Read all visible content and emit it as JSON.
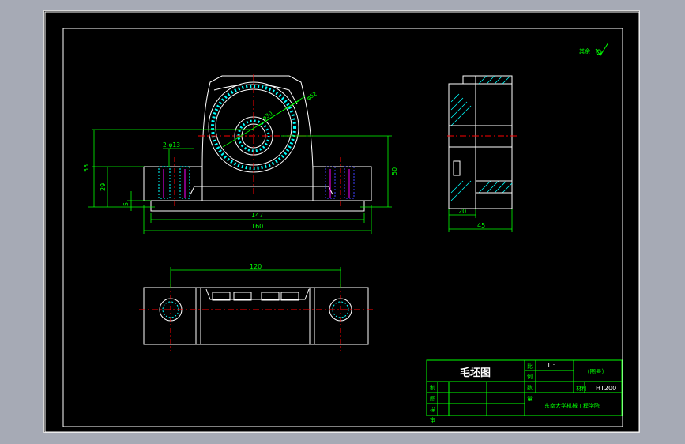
{
  "colors": {
    "background": "#000000",
    "frame": "#ffffff",
    "outline": "#ffffff",
    "dimension": "#00ff00",
    "centerline": "#ff0000",
    "hatch": "#00ffff",
    "hatch_alt": "#4040ff",
    "title_block": "#00ff00"
  },
  "front_view": {
    "labels": {
      "holes": "2-φ13",
      "bore_inner": "φ30",
      "bore_outer": "φ52"
    },
    "dimensions": {
      "height_total": "55",
      "height_foot": "29",
      "base_thickness": "5",
      "center_height": "50",
      "length_inner": "147",
      "length_total": "160"
    }
  },
  "side_view": {
    "dimensions": {
      "flange_width": "20",
      "total_width": "45"
    }
  },
  "top_view": {
    "dimensions": {
      "hole_spacing": "120"
    }
  },
  "surface_mark": {
    "text": "其余"
  },
  "title_block": {
    "drawing_name": "毛坯图",
    "row_labels": [
      "制",
      "图",
      "描",
      "审"
    ],
    "right_labels": [
      "比",
      "例",
      "数",
      "量"
    ],
    "scale_value": "1 : 1",
    "drawing_no": "（图号）",
    "material_label": "材料",
    "material": "HT200",
    "institution": "东南大学机械工程学院"
  }
}
